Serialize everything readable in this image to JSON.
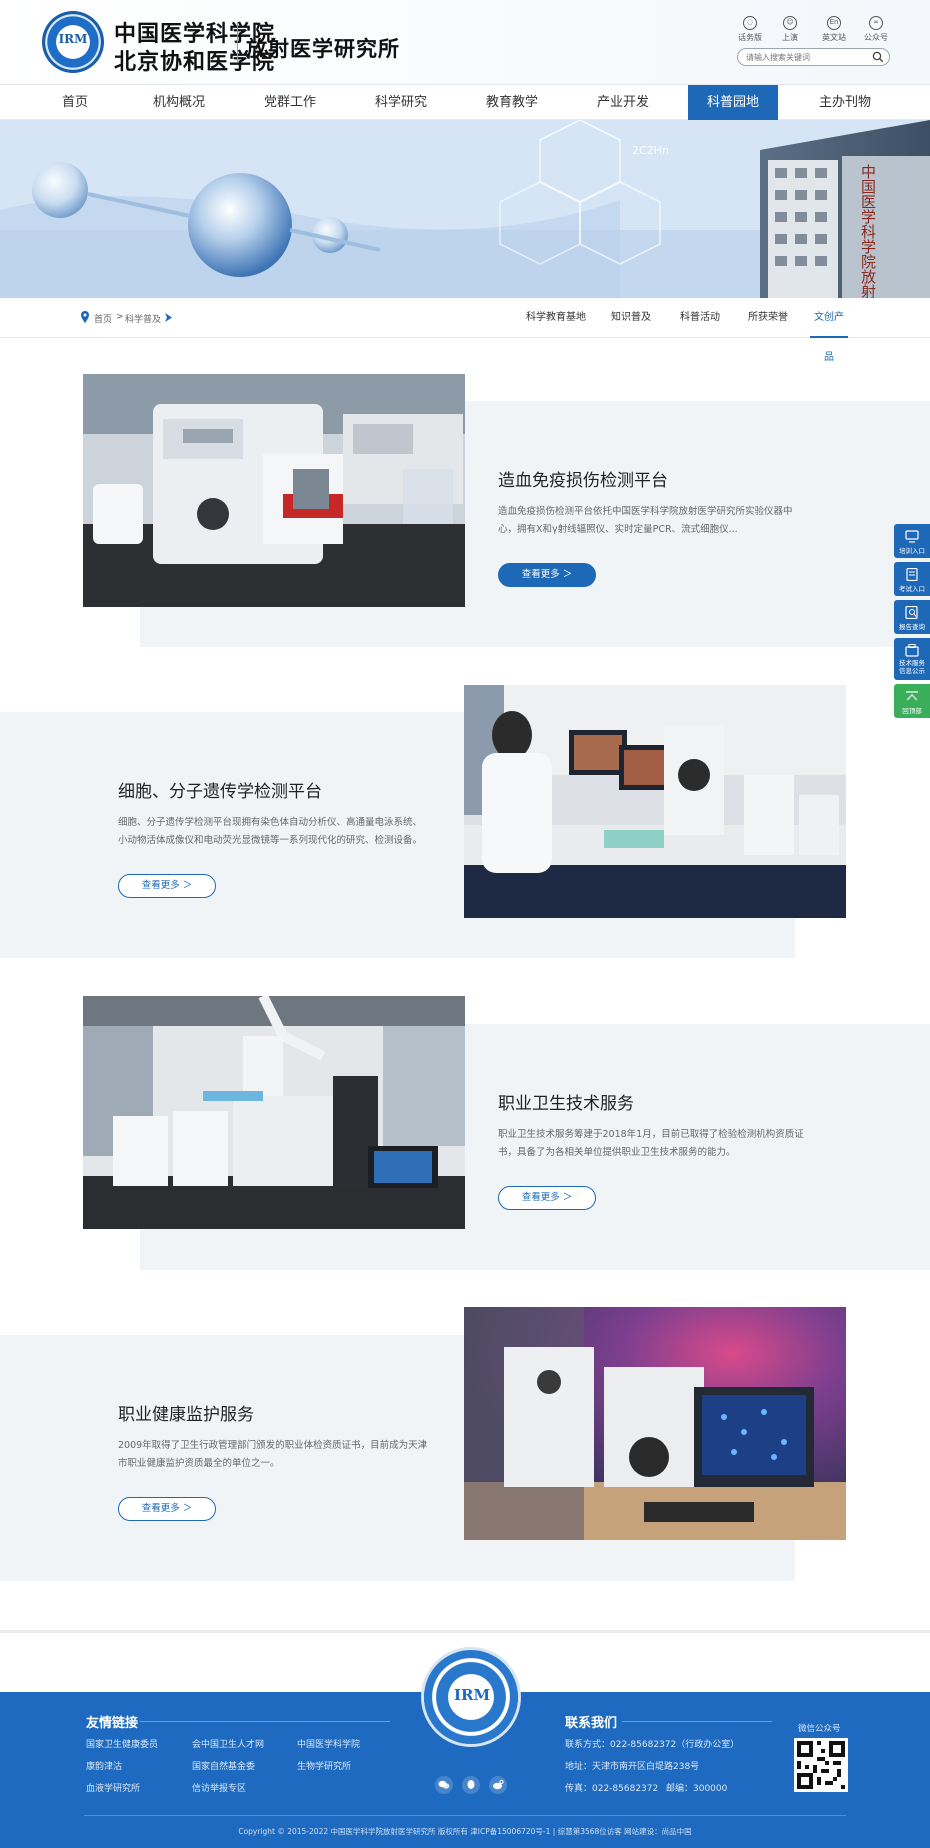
{
  "header": {
    "logo_line1": "中国医学科学院",
    "logo_line2": "北京协和医学院",
    "logo_line3": "放射医学研究所",
    "emblem_text": "IRM",
    "top_links": [
      {
        "label": "话务版",
        "icon": "chat-icon"
      },
      {
        "label": "上演",
        "icon": "user-icon"
      },
      {
        "label": "英文站",
        "icon": "english-icon"
      },
      {
        "label": "公众号",
        "icon": "wechat-icon"
      }
    ],
    "search_placeholder": "请输入搜索关键词"
  },
  "nav": {
    "items": [
      {
        "label": "首页",
        "active": false
      },
      {
        "label": "机构概况",
        "active": false
      },
      {
        "label": "党群工作",
        "active": false
      },
      {
        "label": "科学研究",
        "active": false
      },
      {
        "label": "教育教学",
        "active": false
      },
      {
        "label": "产业开发",
        "active": false
      },
      {
        "label": "科普园地",
        "active": true
      },
      {
        "label": "主办刊物",
        "active": false
      }
    ]
  },
  "banner": {
    "building_text": "中国医学科学院放射医学研究所",
    "chem_label": "2C2Hn"
  },
  "breadcrumb": {
    "home": "首页",
    "sep": ">",
    "current": "科学普及"
  },
  "subtabs": [
    {
      "label": "科学教育基地",
      "active": false
    },
    {
      "label": "知识普及",
      "active": false
    },
    {
      "label": "科普活动",
      "active": false
    },
    {
      "label": "所获荣誉",
      "active": false
    },
    {
      "label": "文创产品",
      "active": true
    }
  ],
  "cards": [
    {
      "title": "造血免疫损伤检测平台",
      "desc": "造血免疫损伤检测平台依托中国医学科学院放射医学研究所实验仪器中心，拥有X和γ射线辐照仪、实时定量PCR、流式细胞仪...",
      "button": "查看更多  ＞"
    },
    {
      "title": "细胞、分子遗传学检测平台",
      "desc": "细胞、分子遗传学检测平台现拥有染色体自动分析仪、高通量电泳系统、小动物活体成像仪和电动荧光显微镜等一系列现代化的研究、检测设备。",
      "button": "查看更多  ＞"
    },
    {
      "title": "职业卫生技术服务",
      "desc": "职业卫生技术服务筹建于2018年1月，目前已取得了检验检测机构资质证书，具备了为各相关单位提供职业卫生技术服务的能力。",
      "button": "查看更多  ＞"
    },
    {
      "title": "职业健康监护服务",
      "desc": " 2009年取得了卫生行政管理部门颁发的职业体检资质证书，目前成为天津市职业健康监护资质最全的单位之一。",
      "button": "查看更多  ＞"
    }
  ],
  "side_float": [
    {
      "label": "培训入口",
      "icon": "training-icon",
      "color": "#1e68b8"
    },
    {
      "label": "考试入口",
      "icon": "exam-icon",
      "color": "#1e68b8"
    },
    {
      "label": "报告查询",
      "icon": "report-search-icon",
      "color": "#1e68b8"
    },
    {
      "label": "技术服务信息公示",
      "icon": "service-info-icon",
      "color": "#1e68b8"
    },
    {
      "label": "回顶部",
      "icon": "back-to-top-icon",
      "color": "#3aae5a"
    }
  ],
  "footer": {
    "links_title": "友情链接",
    "links": [
      "国家卫生健康委员",
      "会中国卫生人才网",
      "中国医学科学院",
      "康韵津沽",
      "国家自然基金委",
      "生物学研究所",
      "血液学研究所",
      "信访举报专区"
    ],
    "contact_title": "联系我们",
    "contact": [
      "联系方式：022-85682372（行政办公室）",
      "地址：天津市南开区白堤路238号",
      "传真：022-85682372",
      "邮编：300000"
    ],
    "qr_label": "微信公众号",
    "emblem_text": "IRM",
    "copyright": "Copyright © 2015-2022 中国医学科学院放射医学研究所 版权所有   津ICP备15006720号-1  |  综慧第3568位访客   网站建设：尚品中国"
  }
}
